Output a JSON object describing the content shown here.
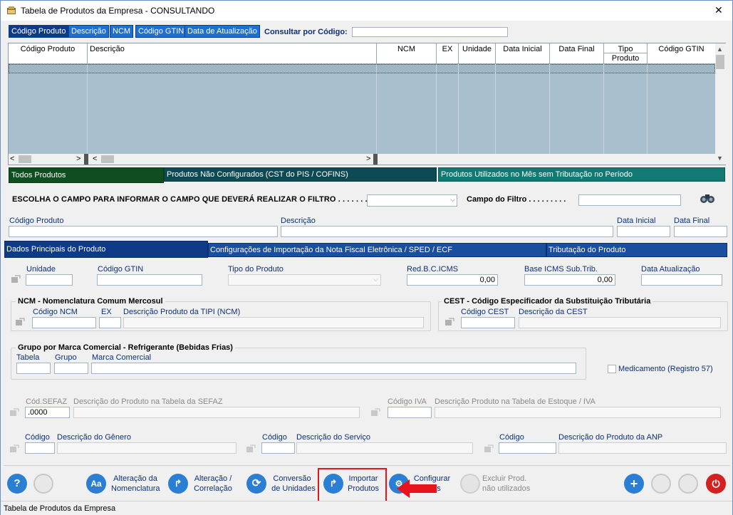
{
  "window": {
    "title": "Tabela de Produtos da Empresa   -   CONSULTANDO",
    "close": "✕"
  },
  "sort_tabs": [
    {
      "label": "Código Produto"
    },
    {
      "label": "Descrição"
    },
    {
      "label": "NCM"
    },
    {
      "label": "Código GTIN"
    },
    {
      "label": "Data de Atualização"
    }
  ],
  "consult": {
    "label": "Consultar por Código:",
    "value": ""
  },
  "grid": {
    "columns": [
      "Código Produto",
      "Descrição",
      "NCM",
      "EX",
      "Unidade",
      "Data Inicial",
      "Data Final",
      "Tipo",
      "Código GTIN"
    ],
    "col_sub": "Produto",
    "scroll_left": "<",
    "scroll_right": ">"
  },
  "filter_tabs": [
    {
      "label": "Todos Produtos"
    },
    {
      "label": "Produtos Não Configurados (CST do PIS / COFINS)"
    },
    {
      "label": "Produtos Utilizados no Mês sem Tributação no Período"
    }
  ],
  "filter": {
    "label": "ESCOLHA O CAMPO PARA INFORMAR O CAMPO QUE DEVERÁ REALIZAR O FILTRO . . . . . . . . . :",
    "field_label": "Campo do Filtro . . . . . . . . .",
    "value": ""
  },
  "search_fields": {
    "codigo": "Código Produto",
    "descricao": "Descrição",
    "data_inicial": "Data Inicial",
    "data_final": "Data Final"
  },
  "section_tabs": [
    {
      "label": "Dados Principais do Produto"
    },
    {
      "label": "Configurações de Importação da Nota Fiscal Eletrônica / SPED / ECF"
    },
    {
      "label": "Tributação do Produto"
    }
  ],
  "main": {
    "unidade": "Unidade",
    "gtin": "Código GTIN",
    "tipo": "Tipo do Produto",
    "red_bc": "Red.B.C.ICMS",
    "red_bc_val": "0,00",
    "base_sub": "Base ICMS Sub.Trib.",
    "base_sub_val": "0,00",
    "data_atualizacao": "Data Atualização"
  },
  "ncm": {
    "title": "NCM - Nomenclatura Comum Mercosul",
    "codigo": "Código NCM",
    "ex": "EX",
    "descricao": "Descrição Produto da TIPI (NCM)"
  },
  "cest": {
    "title": "CEST - Código Especificador da Substituição Tributária",
    "codigo": "Código CEST",
    "descricao": "Descrição da CEST"
  },
  "marca": {
    "title": "Grupo por Marca Comercial - Refrigerante (Bebidas Frias)",
    "tabela": "Tabela",
    "grupo": "Grupo",
    "marca": "Marca Comercial"
  },
  "medicamento": "Medicamento  (Registro  57)",
  "sefaz": {
    "cod": "Cód.SEFAZ",
    "cod_val": ".0000",
    "descricao": "Descrição do Produto na Tabela da SEFAZ",
    "iva": "Código IVA",
    "iva_desc": "Descrição Produto na Tabela de Estoque / IVA"
  },
  "genero": {
    "codigo": "Código",
    "descricao": "Descrição do Gênero",
    "codigo2": "Código",
    "servico": "Descrição do Serviço",
    "codigo3": "Código",
    "anp": "Descrição do Produto da ANP"
  },
  "toolbar": {
    "alteracao1": "Alteração da",
    "alteracao2": "Nomenclatura",
    "correlacao1": "Alteração /",
    "correlacao2": "Correlação",
    "conversao1": "Conversão",
    "conversao2": "de Unidades",
    "importar1": "Importar",
    "importar2": "Produtos",
    "configurar1": "Configurar",
    "configurar2": "os",
    "excluir1": "Excluir Prod.",
    "excluir2": "não utilizados"
  },
  "status": "Tabela de Produtos da Empresa",
  "colors": {
    "accent": "#1f6fd1",
    "dark_tab": "#0f3a86",
    "highlight": "#e8141c"
  }
}
